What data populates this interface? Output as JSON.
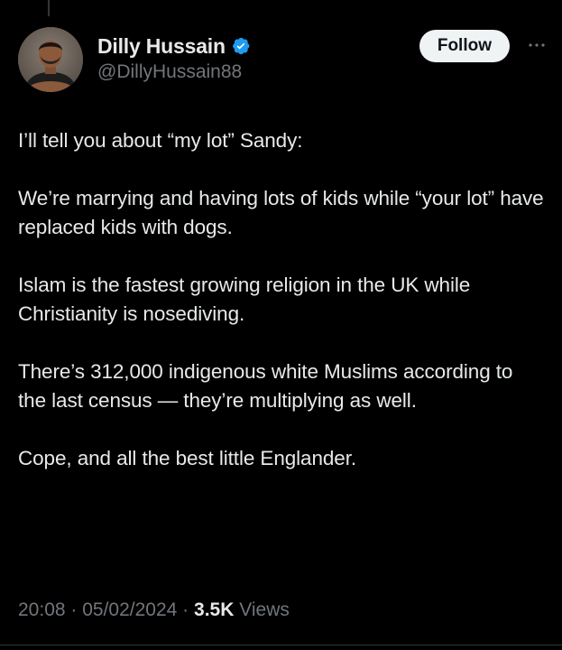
{
  "author": {
    "display_name": "Dilly Hussain",
    "handle": "@DillyHussain88",
    "verified_icon": "verified-badge-icon",
    "avatar_icon": "profile-photo-avatar"
  },
  "actions": {
    "follow_label": "Follow",
    "more_icon": "more-horizontal-icon"
  },
  "tweet": {
    "paragraphs": [
      "I’ll tell you about “my lot” Sandy:",
      "We’re marrying and having lots of kids while “your lot” have replaced kids with dogs.",
      "Islam is the fastest growing religion in the UK while Christianity is nosediving.",
      "There’s 312,000 indigenous white Muslims according to the last census — they’re multiplying as well.",
      "Cope, and all the best little Englander."
    ]
  },
  "meta": {
    "time": "20:08",
    "separator": " · ",
    "date": "05/02/2024",
    "views_count": "3.5K",
    "views_label": "Views"
  },
  "colors": {
    "background": "#000000",
    "text_primary": "#e7e9ea",
    "text_secondary": "#71767b",
    "verified_blue": "#1d9bf0",
    "follow_bg": "#eff3f4",
    "follow_text": "#0f1419"
  }
}
